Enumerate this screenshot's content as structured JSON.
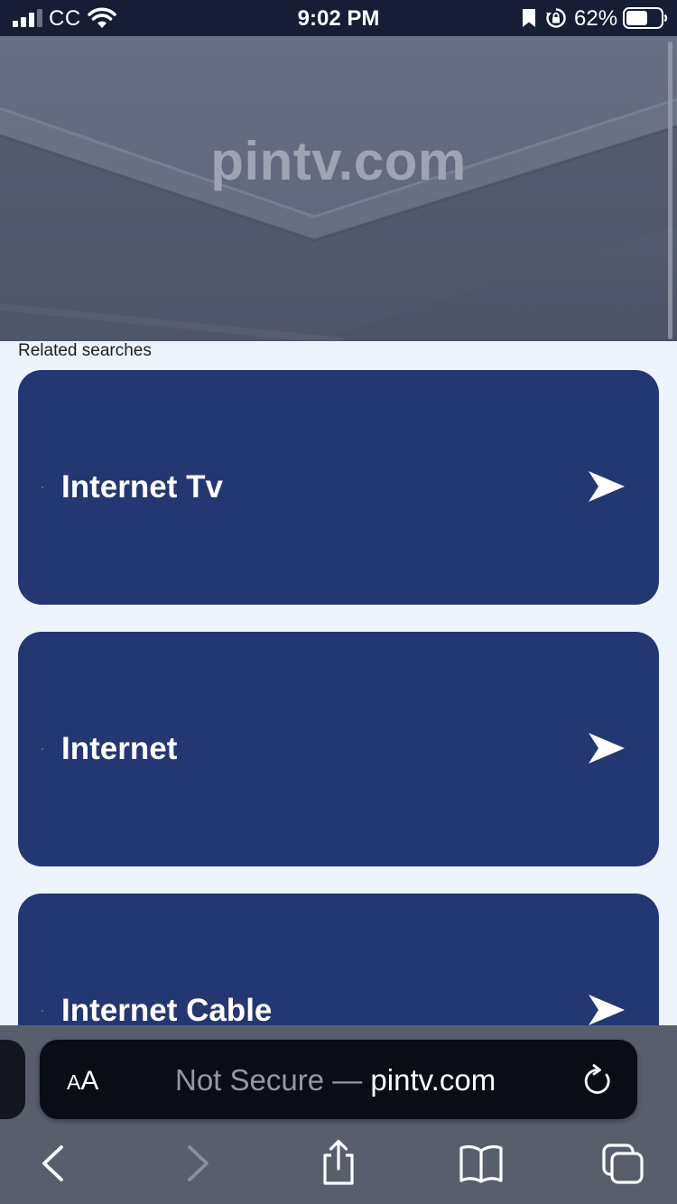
{
  "status_bar": {
    "carrier": "CC",
    "time": "9:02 PM",
    "battery_percent": "62%",
    "battery_level": 0.62,
    "signal_bars": 3,
    "icons": [
      "signal-icon",
      "wifi-icon",
      "bookmark-icon",
      "orientation-lock-icon",
      "battery-icon"
    ]
  },
  "hero": {
    "title": "pintv.com"
  },
  "related": {
    "label": "Related searches",
    "items": [
      {
        "label": "Internet Tv",
        "icon": "arrow-right-icon"
      },
      {
        "label": "Internet",
        "icon": "arrow-right-icon"
      },
      {
        "label": "Internet Cable",
        "icon": "arrow-right-icon"
      }
    ]
  },
  "address_bar": {
    "text_size_button": "AA",
    "security_label": "Not Secure —",
    "host": "pintv.com",
    "reload_icon": "reload-icon"
  },
  "toolbar": {
    "icons": [
      "back-icon",
      "forward-icon",
      "share-icon",
      "bookmarks-icon",
      "tabs-icon"
    ]
  },
  "colors": {
    "status_bar_bg": "#161d35",
    "hero_bg": "#5a6275",
    "page_bg": "#eef4fb",
    "card_bg": "#233772",
    "toolbar_bg": "#585e6c",
    "address_bar_bg": "#0a0d16"
  }
}
